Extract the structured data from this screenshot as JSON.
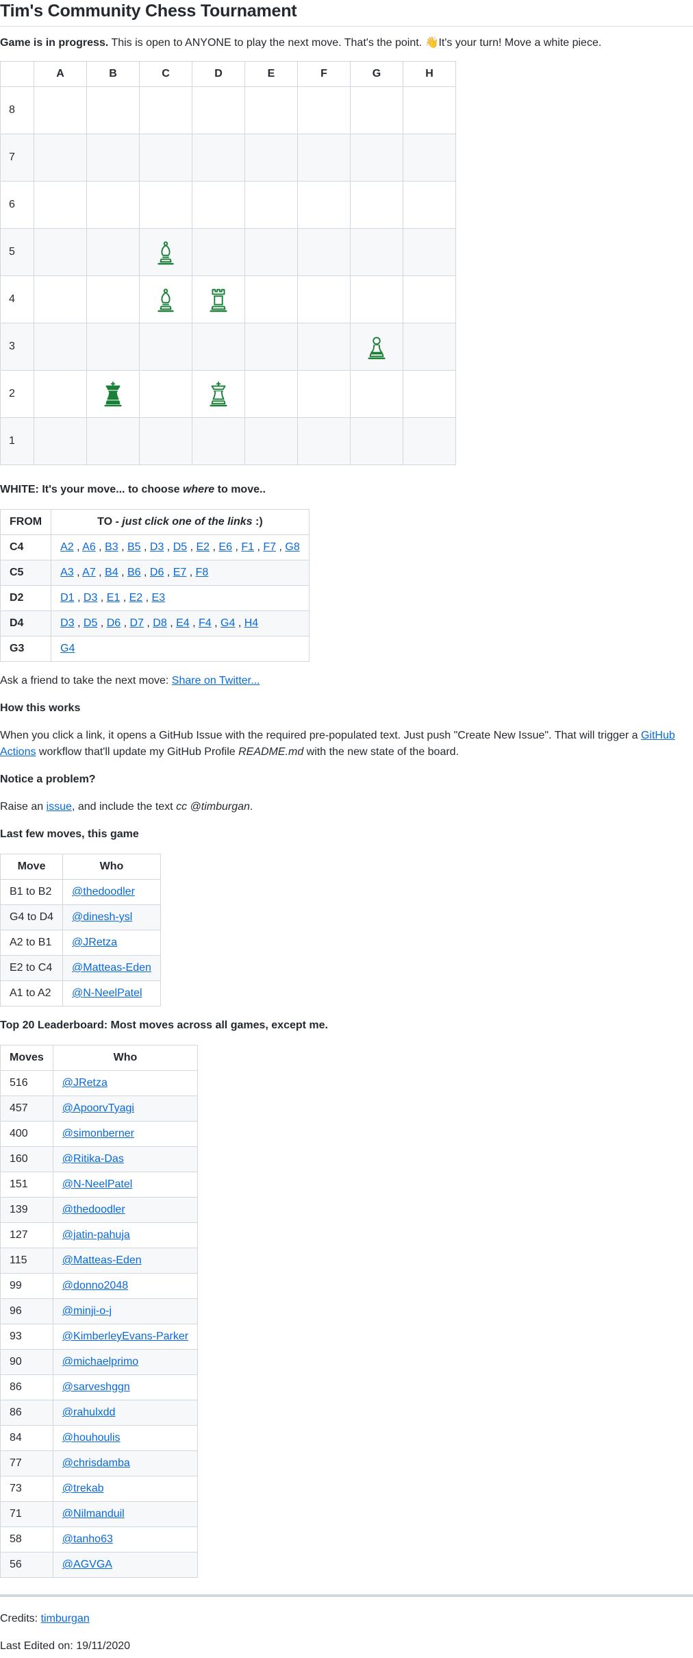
{
  "title": "Tim's Community Chess Tournament",
  "intro": {
    "status_bold": "Game is in progress.",
    "text": " This is open to ANYONE to play the next move. That's the point. ",
    "wave_emoji": "👋",
    "turn": "It's your turn! Move a white piece."
  },
  "board": {
    "files": [
      "A",
      "B",
      "C",
      "D",
      "E",
      "F",
      "G",
      "H"
    ],
    "ranks": [
      "8",
      "7",
      "6",
      "5",
      "4",
      "3",
      "2",
      "1"
    ],
    "pieces": [
      {
        "square": "C5",
        "piece": "white-bishop-icon"
      },
      {
        "square": "C4",
        "piece": "white-bishop-icon"
      },
      {
        "square": "D4",
        "piece": "white-rook-icon"
      },
      {
        "square": "G3",
        "piece": "white-pawn-icon"
      },
      {
        "square": "B2",
        "piece": "black-king-icon"
      },
      {
        "square": "D2",
        "piece": "white-king-icon"
      }
    ],
    "piece_color": "#1a7f37"
  },
  "move_prompt": {
    "before": "WHITE: It's your move... to choose ",
    "em": "where",
    "after": " to move.."
  },
  "moves_table": {
    "header_from": "FROM",
    "header_to_prefix": "TO - ",
    "header_to_em": "just click one of the links",
    "header_to_suffix": " :)",
    "rows": [
      {
        "from": "C4",
        "to": [
          "A2",
          "A6",
          "B3",
          "B5",
          "D3",
          "D5",
          "E2",
          "E6",
          "F1",
          "F7",
          "G8"
        ]
      },
      {
        "from": "C5",
        "to": [
          "A3",
          "A7",
          "B4",
          "B6",
          "D6",
          "E7",
          "F8"
        ]
      },
      {
        "from": "D2",
        "to": [
          "D1",
          "D3",
          "E1",
          "E2",
          "E3"
        ]
      },
      {
        "from": "D4",
        "to": [
          "D3",
          "D5",
          "D6",
          "D7",
          "D8",
          "E4",
          "F4",
          "G4",
          "H4"
        ]
      },
      {
        "from": "G3",
        "to": [
          "G4"
        ]
      }
    ]
  },
  "share": {
    "text": "Ask a friend to take the next move: ",
    "link": "Share on Twitter..."
  },
  "how": {
    "heading": "How this works",
    "text1": "When you click a link, it opens a GitHub Issue with the required pre-populated text. Just push \"Create New Issue\". That will trigger a ",
    "link1": "GitHub",
    "link2": "Actions",
    "text2": " workflow that'll update my GitHub Profile ",
    "em": "README.md",
    "text3": " with the new state of the board."
  },
  "problem": {
    "heading": "Notice a problem?",
    "text1": "Raise an ",
    "link": "issue",
    "text2": ", and include the text ",
    "em": "cc @timburgan",
    "text3": "."
  },
  "last_moves": {
    "heading": "Last few moves, this game",
    "header_move": "Move",
    "header_who": "Who",
    "rows": [
      {
        "move": "B1 to B2",
        "who": "@thedoodler"
      },
      {
        "move": "G4 to D4",
        "who": "@dinesh-ysl"
      },
      {
        "move": "A2 to B1",
        "who": "@JRetza"
      },
      {
        "move": "E2 to C4",
        "who": "@Matteas-Eden"
      },
      {
        "move": "A1 to A2",
        "who": "@N-NeelPatel"
      }
    ]
  },
  "leaderboard": {
    "heading": "Top 20 Leaderboard: Most moves across all games, except me.",
    "header_moves": "Moves",
    "header_who": "Who",
    "rows": [
      {
        "moves": "516",
        "who": "@JRetza"
      },
      {
        "moves": "457",
        "who": "@ApoorvTyagi"
      },
      {
        "moves": "400",
        "who": "@simonberner"
      },
      {
        "moves": "160",
        "who": "@Ritika-Das"
      },
      {
        "moves": "151",
        "who": "@N-NeelPatel"
      },
      {
        "moves": "139",
        "who": "@thedoodler"
      },
      {
        "moves": "127",
        "who": "@jatin-pahuja"
      },
      {
        "moves": "115",
        "who": "@Matteas-Eden"
      },
      {
        "moves": "99",
        "who": "@donno2048"
      },
      {
        "moves": "96",
        "who": "@minji-o-j"
      },
      {
        "moves": "93",
        "who": "@KimberleyEvans-Parker"
      },
      {
        "moves": "90",
        "who": "@michaelprimo"
      },
      {
        "moves": "86",
        "who": "@sarveshggn"
      },
      {
        "moves": "86",
        "who": "@rahulxdd"
      },
      {
        "moves": "84",
        "who": "@houhoulis"
      },
      {
        "moves": "77",
        "who": "@chrisdamba"
      },
      {
        "moves": "73",
        "who": "@trekab"
      },
      {
        "moves": "71",
        "who": "@Nilmanduil"
      },
      {
        "moves": "58",
        "who": "@tanho63"
      },
      {
        "moves": "56",
        "who": "@AGVGA"
      }
    ]
  },
  "footer": {
    "credits_label": "Credits: ",
    "credits_link": "timburgan",
    "last_edited": "Last Edited on: 19/11/2020"
  }
}
